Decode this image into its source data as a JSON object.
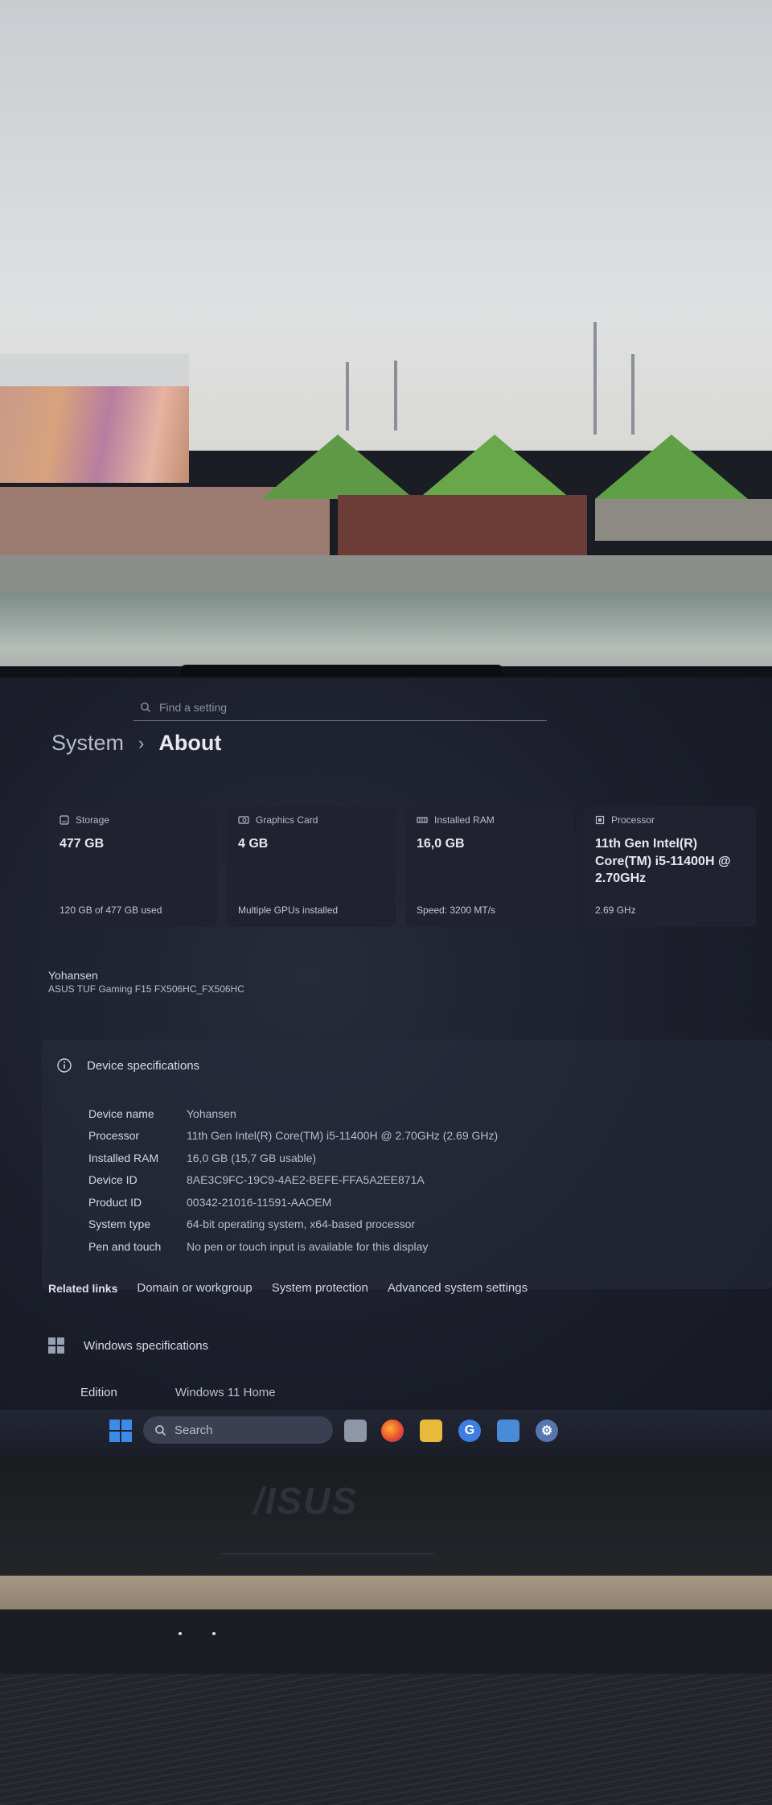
{
  "settings": {
    "search_placeholder": "Find a setting",
    "breadcrumb": {
      "parent": "System",
      "separator": "›",
      "current": "About"
    }
  },
  "summary_cards": [
    {
      "icon": "storage-icon",
      "label": "Storage",
      "value": "477 GB",
      "footer": "120 GB of 477 GB used"
    },
    {
      "icon": "graphics-card-icon",
      "label": "Graphics Card",
      "value": "4 GB",
      "footer": "Multiple GPUs installed"
    },
    {
      "icon": "ram-icon",
      "label": "Installed RAM",
      "value": "16,0 GB",
      "footer": "Speed: 3200 MT/s"
    },
    {
      "icon": "processor-icon",
      "label": "Processor",
      "value": "11th Gen Intel(R) Core(TM) i5-11400H @ 2.70GHz",
      "footer": "2.69 GHz"
    }
  ],
  "device": {
    "name": "Yohansen",
    "model": "ASUS TUF Gaming F15 FX506HC_FX506HC"
  },
  "device_specs": {
    "title": "Device specifications",
    "rows": [
      {
        "label": "Device name",
        "value": "Yohansen"
      },
      {
        "label": "Processor",
        "value": "11th Gen Intel(R) Core(TM) i5-11400H @ 2.70GHz (2.69 GHz)"
      },
      {
        "label": "Installed RAM",
        "value": "16,0 GB (15,7 GB usable)"
      },
      {
        "label": "Device ID",
        "value": "8AE3C9FC-19C9-4AE2-BEFE-FFA5A2EE871A"
      },
      {
        "label": "Product ID",
        "value": "00342-21016-11591-AAOEM"
      },
      {
        "label": "System type",
        "value": "64-bit operating system, x64-based processor"
      },
      {
        "label": "Pen and touch",
        "value": "No pen or touch input is available for this display"
      }
    ]
  },
  "related_links": {
    "title": "Related links",
    "links": [
      "Domain or workgroup",
      "System protection",
      "Advanced system settings"
    ]
  },
  "windows_specs": {
    "title": "Windows specifications",
    "edition_label": "Edition",
    "edition_value": "Windows 11 Home"
  },
  "taskbar": {
    "search_label": "Search",
    "apps": [
      "task-view-icon",
      "firefox-icon",
      "file-explorer-icon",
      "google-icon",
      "remote-desktop-icon",
      "settings-gear-icon"
    ]
  },
  "laptop_brand": "/ISUS"
}
